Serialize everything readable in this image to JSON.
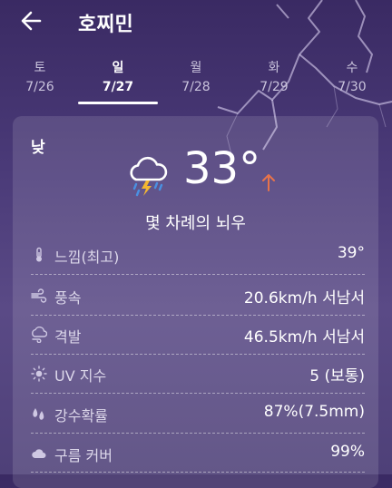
{
  "header": {
    "title": "호찌민"
  },
  "tabs": [
    {
      "day": "토",
      "date": "7/26",
      "active": false
    },
    {
      "day": "일",
      "date": "7/27",
      "active": true
    },
    {
      "day": "월",
      "date": "7/28",
      "active": false
    },
    {
      "day": "화",
      "date": "7/29",
      "active": false
    },
    {
      "day": "수",
      "date": "7/30",
      "active": false
    }
  ],
  "forecast": {
    "period": "낮",
    "temperature": "33°",
    "condition": "몇 차례의 뇌우",
    "condition_icon": "thunderstorm-icon",
    "trend_icon": "arrow-up-icon",
    "trend_color": "#e8734a"
  },
  "details": [
    {
      "icon": "thermometer-icon",
      "label": "느낌(최고)",
      "value": "39°"
    },
    {
      "icon": "wind-icon",
      "label": "풍속",
      "value": "20.6km/h 서남서"
    },
    {
      "icon": "gust-icon",
      "label": "격발",
      "value": "46.5km/h 서남서"
    },
    {
      "icon": "sun-icon",
      "label": "UV 지수",
      "value": "5 (보통)"
    },
    {
      "icon": "rain-drops-icon",
      "label": "강수확률",
      "value": "87%(7.5mm)"
    },
    {
      "icon": "cloud-icon",
      "label": "구름 커버",
      "value": "99%"
    }
  ]
}
